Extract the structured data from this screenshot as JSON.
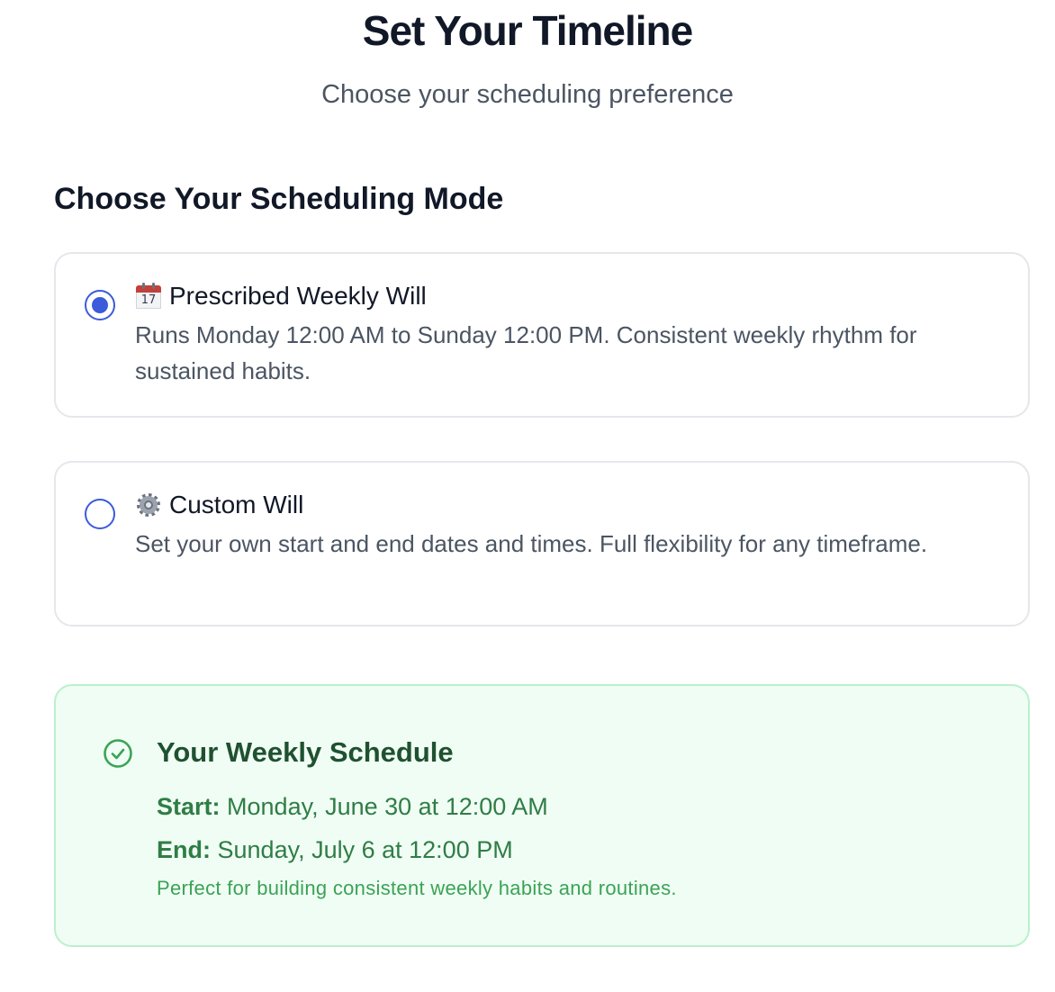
{
  "header": {
    "title": "Set Your Timeline",
    "subtitle": "Choose your scheduling preference"
  },
  "mode_section": {
    "title": "Choose Your Scheduling Mode",
    "options": [
      {
        "icon": "calendar-icon",
        "title": "Prescribed Weekly Will",
        "description": "Runs Monday 12:00 AM to Sunday 12:00 PM. Consistent weekly rhythm for sustained habits.",
        "selected": true,
        "calendar_day": "17"
      },
      {
        "icon": "gear-icon",
        "title": "Custom Will",
        "description": "Set your own start and end dates and times. Full flexibility for any timeframe.",
        "selected": false
      }
    ]
  },
  "schedule": {
    "icon": "check-circle-icon",
    "title": "Your Weekly Schedule",
    "start_label": "Start:",
    "start_value": "Monday, June 30 at 12:00 AM",
    "end_label": "End:",
    "end_value": "Sunday, July 6 at 12:00 PM",
    "note": "Perfect for building consistent weekly habits and routines."
  },
  "colors": {
    "accent": "#3b5bdb",
    "success_bg": "#f0fdf4",
    "success_border": "#bbf0cc",
    "success_text": "#2f7d45"
  }
}
